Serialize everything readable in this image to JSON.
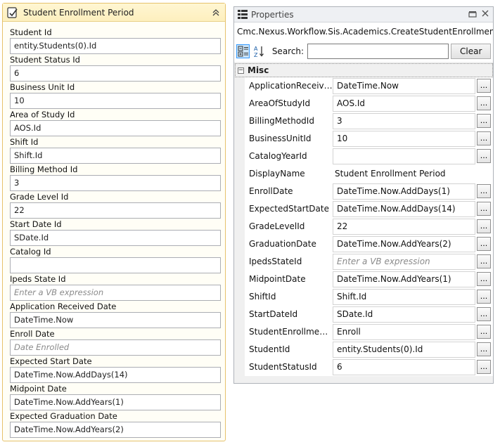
{
  "activity": {
    "title": "Student Enrollment Period",
    "fields": [
      {
        "label": "Student Id",
        "value": "entity.Students(0).Id"
      },
      {
        "label": "Student Status Id",
        "value": "6"
      },
      {
        "label": "Business Unit Id",
        "value": "10"
      },
      {
        "label": "Area of Study Id",
        "value": "AOS.Id"
      },
      {
        "label": "Shift Id",
        "value": "Shift.Id"
      },
      {
        "label": "Billing Method Id",
        "value": "3"
      },
      {
        "label": "Grade Level Id",
        "value": "22"
      },
      {
        "label": "Start Date Id",
        "value": "SDate.Id"
      },
      {
        "label": "Catalog Id",
        "value": ""
      },
      {
        "label": "Ipeds State Id",
        "value": "",
        "placeholder": "Enter a VB expression"
      },
      {
        "label": "Application Received Date",
        "value": "DateTime.Now"
      },
      {
        "label": "Enroll Date",
        "value": "",
        "placeholder": "Date Enrolled"
      },
      {
        "label": "Expected Start Date",
        "value": "DateTime.Now.AddDays(14)"
      },
      {
        "label": "Midpoint Date",
        "value": "DateTime.Now.AddYears(1)"
      },
      {
        "label": "Expected Graduation Date",
        "value": "DateTime.Now.AddYears(2)"
      }
    ]
  },
  "properties": {
    "title": "Properties",
    "type_name": "Cmc.Nexus.Workflow.Sis.Academics.CreateStudentEnrollmentPeriod",
    "search_label": "Search:",
    "search_value": "",
    "clear_label": "Clear",
    "category": "Misc",
    "rows": [
      {
        "name": "ApplicationReceive...",
        "value": "DateTime.Now",
        "button": true
      },
      {
        "name": "AreaOfStudyId",
        "value": "AOS.Id",
        "button": true
      },
      {
        "name": "BillingMethodId",
        "value": "3",
        "button": true
      },
      {
        "name": "BusinessUnitId",
        "value": "10",
        "button": true
      },
      {
        "name": "CatalogYearId",
        "value": "",
        "button": true
      },
      {
        "name": "DisplayName",
        "value": "Student Enrollment Period",
        "button": false
      },
      {
        "name": "EnrollDate",
        "value": "DateTime.Now.AddDays(1)",
        "button": true
      },
      {
        "name": "ExpectedStartDate",
        "value": "DateTime.Now.AddDays(14)",
        "button": true
      },
      {
        "name": "GradeLevelId",
        "value": "22",
        "button": true
      },
      {
        "name": "GraduationDate",
        "value": "DateTime.Now.AddYears(2)",
        "button": true
      },
      {
        "name": "IpedsStateId",
        "value": "",
        "placeholder": "Enter a VB expression",
        "button": true
      },
      {
        "name": "MidpointDate",
        "value": "DateTime.Now.AddYears(1)",
        "button": true
      },
      {
        "name": "ShiftId",
        "value": "Shift.Id",
        "button": true
      },
      {
        "name": "StartDateId",
        "value": "SDate.Id",
        "button": true
      },
      {
        "name": "StudentEnrollmentP...",
        "value": "Enroll",
        "button": true
      },
      {
        "name": "StudentId",
        "value": "entity.Students(0).Id",
        "button": true
      },
      {
        "name": "StudentStatusId",
        "value": "6",
        "button": true
      }
    ],
    "ellipsis_label": "..."
  },
  "icons": {
    "activity": "activity-icon",
    "collapse": "double-chevron-up-icon",
    "properties": "properties-grid-icon",
    "categorized": "categorized-icon",
    "alphabetical": "sort-alphabetical-icon",
    "pin": "pin-icon",
    "close": "close-icon"
  }
}
